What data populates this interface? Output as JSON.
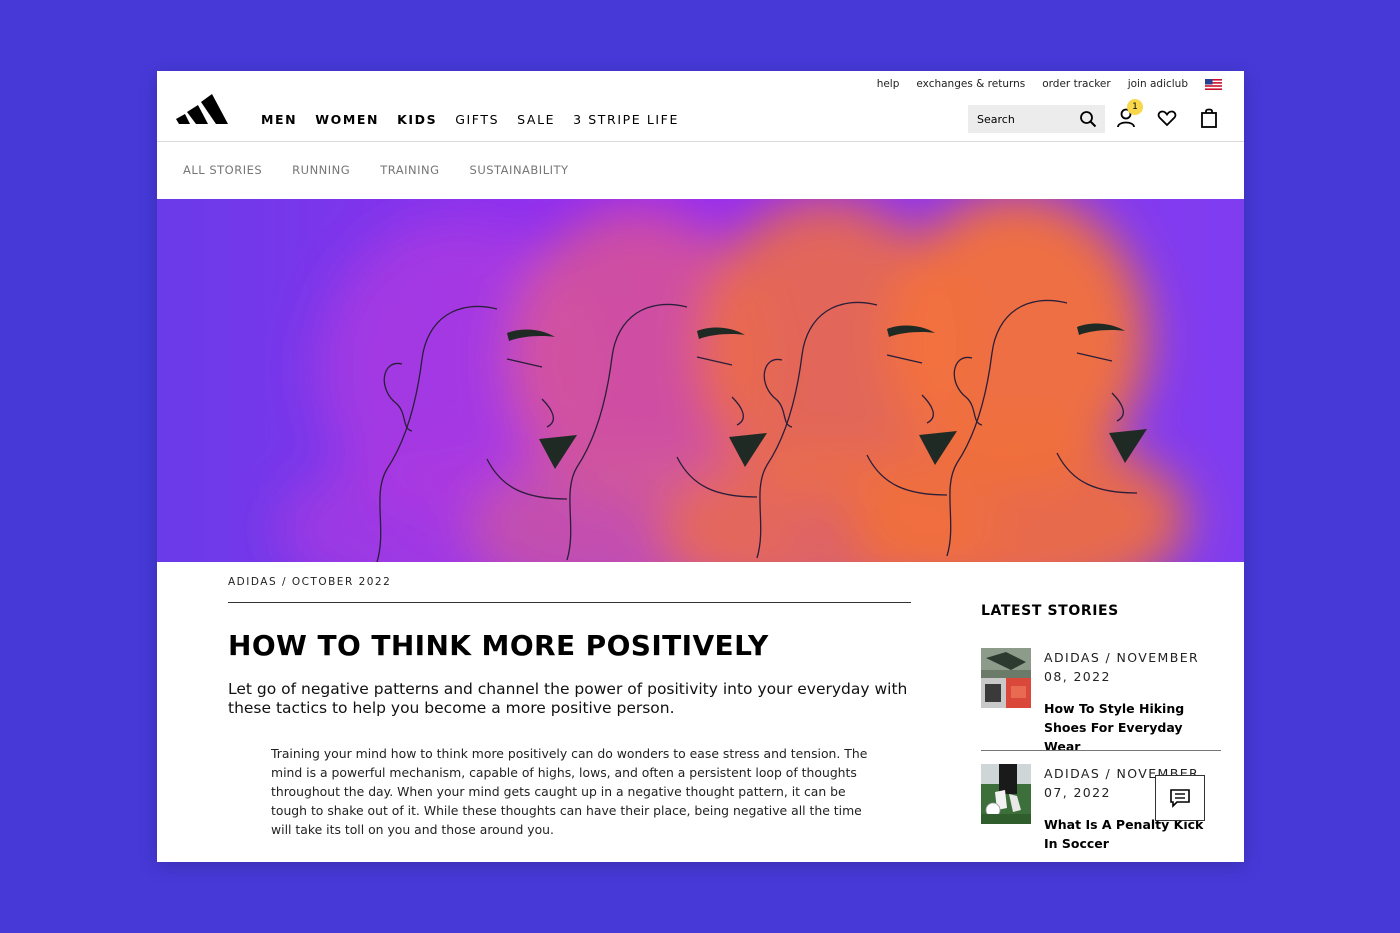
{
  "header": {
    "util_links": [
      "help",
      "exchanges & returns",
      "order tracker",
      "join adiclub"
    ],
    "nav": [
      "MEN",
      "WOMEN",
      "KIDS",
      "GIFTS",
      "SALE",
      "3 STRIPE LIFE"
    ],
    "search_placeholder": "Search",
    "badge_count": "1"
  },
  "subnav": [
    "ALL STORIES",
    "RUNNING",
    "TRAINING",
    "SUSTAINABILITY"
  ],
  "article": {
    "byline": "ADIDAS / OCTOBER 2022",
    "title": "HOW TO THINK MORE POSITIVELY",
    "lede": "Let go of negative patterns and channel the power of positivity into your everyday with these tactics to help you become a more positive person.",
    "body": "Training your mind how to think more positively can do wonders to ease stress and tension. The mind is a powerful mechanism, capable of highs, lows, and often a persistent loop of thoughts throughout the day. When your mind gets caught up in a negative thought pattern, it can be tough to shake out of it. While these thoughts can have their place, being negative all the time will take its toll on you and those around you."
  },
  "sidebar": {
    "title": "LATEST STORIES",
    "stories": [
      {
        "meta": "ADIDAS / NOVEMBER 08, 2022",
        "title": "How To Style Hiking Shoes For Everyday Wear"
      },
      {
        "meta": "ADIDAS / NOVEMBER 07, 2022",
        "title": "What Is A Penalty Kick In Soccer"
      }
    ]
  },
  "colors": {
    "page_bg": "#4639d8",
    "hero_purple": "#9a2cf0",
    "hero_orange": "#f2703a",
    "badge": "#f9d74a"
  }
}
